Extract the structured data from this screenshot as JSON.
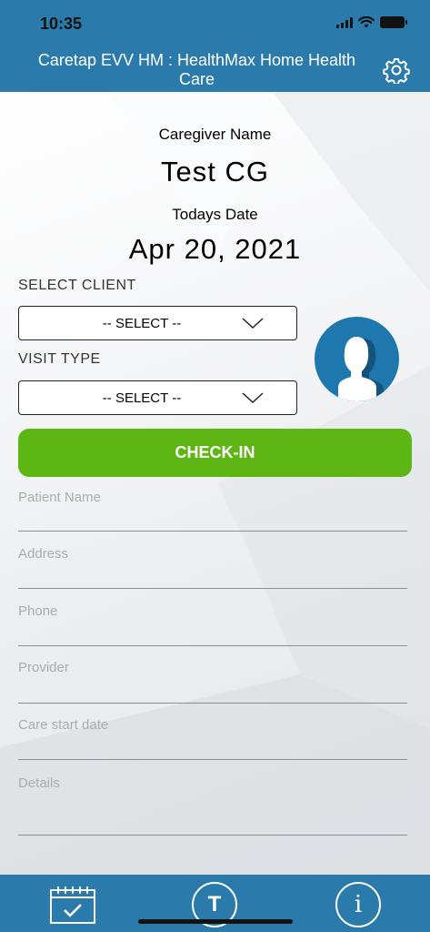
{
  "status_bar": {
    "time": "10:35"
  },
  "header": {
    "title": "Caretap EVV HM : HealthMax Home Health Care",
    "settings_icon": "gear-icon"
  },
  "caregiver": {
    "label": "Caregiver Name",
    "name": "Test CG"
  },
  "date": {
    "label": "Todays Date",
    "value": "Apr 20, 2021"
  },
  "select_client": {
    "label": "SELECT CLIENT",
    "value": "-- SELECT --"
  },
  "visit_type": {
    "label": "VISIT TYPE",
    "value": "-- SELECT --"
  },
  "checkin": {
    "label": "CHECK-IN"
  },
  "fields": [
    {
      "placeholder": "Patient Name"
    },
    {
      "placeholder": "Address"
    },
    {
      "placeholder": "Phone"
    },
    {
      "placeholder": "Provider"
    },
    {
      "placeholder": "Care start date"
    },
    {
      "placeholder": "Details"
    }
  ],
  "tabbar": {
    "calendar_icon": "calendar-check-icon",
    "t_label": "T",
    "i_label": "i"
  },
  "colors": {
    "header": "#2a7bab",
    "checkin": "#5db614",
    "avatar": "#1f78ad"
  }
}
